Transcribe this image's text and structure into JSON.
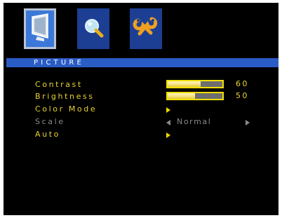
{
  "tabs": [
    {
      "icon": "monitor-icon",
      "selected": true
    },
    {
      "icon": "magnifier-icon",
      "selected": false
    },
    {
      "icon": "tools-icon",
      "selected": false
    }
  ],
  "title": "PICTURE",
  "menu": {
    "contrast": {
      "label": "Contrast",
      "value": "60",
      "level_percent": 60
    },
    "brightness": {
      "label": "Brightness",
      "value": "50",
      "level_percent": 50
    },
    "color_mode": {
      "label": "Color Mode"
    },
    "scale": {
      "label": "Scale",
      "value": "Normal",
      "enabled": false
    },
    "auto": {
      "label": "Auto"
    }
  },
  "colors": {
    "background": "#000000",
    "accent_blue": "#2a5cc6",
    "label_yellow": "#e8d430",
    "disabled_grey": "#8a8a8a",
    "slider_border": "#f0e000"
  }
}
